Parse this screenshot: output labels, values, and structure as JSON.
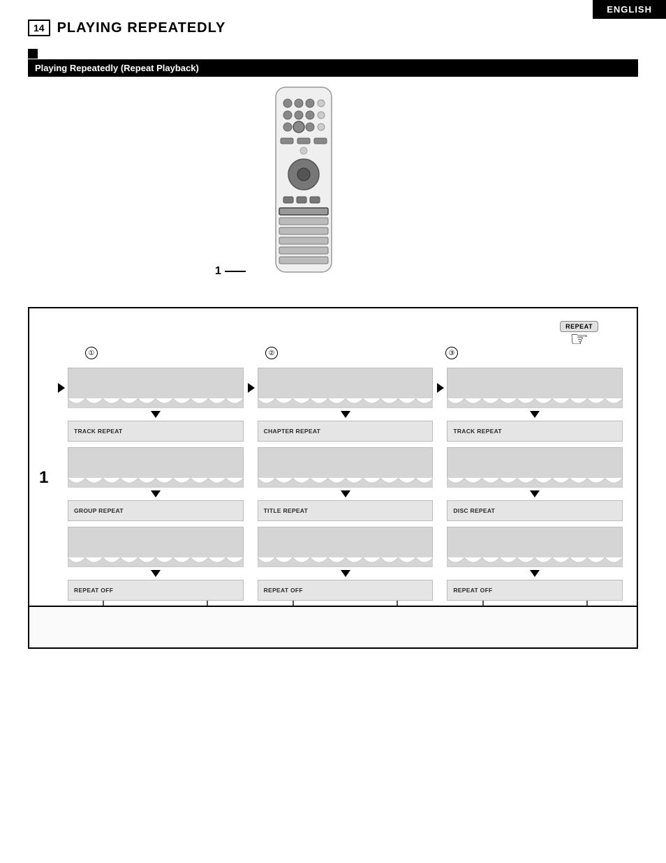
{
  "topBar": {
    "language": "ENGLISH"
  },
  "header": {
    "pageNum": "14",
    "title": "PLAYING REPEATEDLY"
  },
  "sectionBar": {
    "label": "Playing Repeatedly (Repeat Playback)"
  },
  "remoteLabel": "1",
  "repeatBtn": "REPEAT",
  "stepNumbers": [
    "①",
    "②",
    "③"
  ],
  "diagramStepLabel": "1",
  "columns": [
    {
      "number": "①",
      "cards": [
        {
          "hasWave": true,
          "label": ""
        },
        {
          "hasWave": false,
          "label": "TRACK REPEAT"
        },
        {
          "hasWave": true,
          "label": ""
        },
        {
          "hasWave": false,
          "label": "GROUP REPEAT"
        },
        {
          "hasWave": true,
          "label": ""
        },
        {
          "hasWave": false,
          "label": "REPEAT OFF"
        }
      ]
    },
    {
      "number": "②",
      "cards": [
        {
          "hasWave": true,
          "label": ""
        },
        {
          "hasWave": false,
          "label": "CHAPTER REPEAT"
        },
        {
          "hasWave": true,
          "label": ""
        },
        {
          "hasWave": false,
          "label": "TITLE REPEAT"
        },
        {
          "hasWave": true,
          "label": ""
        },
        {
          "hasWave": false,
          "label": "REPEAT OFF"
        }
      ]
    },
    {
      "number": "③",
      "cards": [
        {
          "hasWave": true,
          "label": ""
        },
        {
          "hasWave": false,
          "label": "TRACK REPEAT"
        },
        {
          "hasWave": true,
          "label": ""
        },
        {
          "hasWave": false,
          "label": "DISC REPEAT"
        },
        {
          "hasWave": true,
          "label": ""
        },
        {
          "hasWave": false,
          "label": "REPEAT OFF"
        }
      ]
    }
  ]
}
